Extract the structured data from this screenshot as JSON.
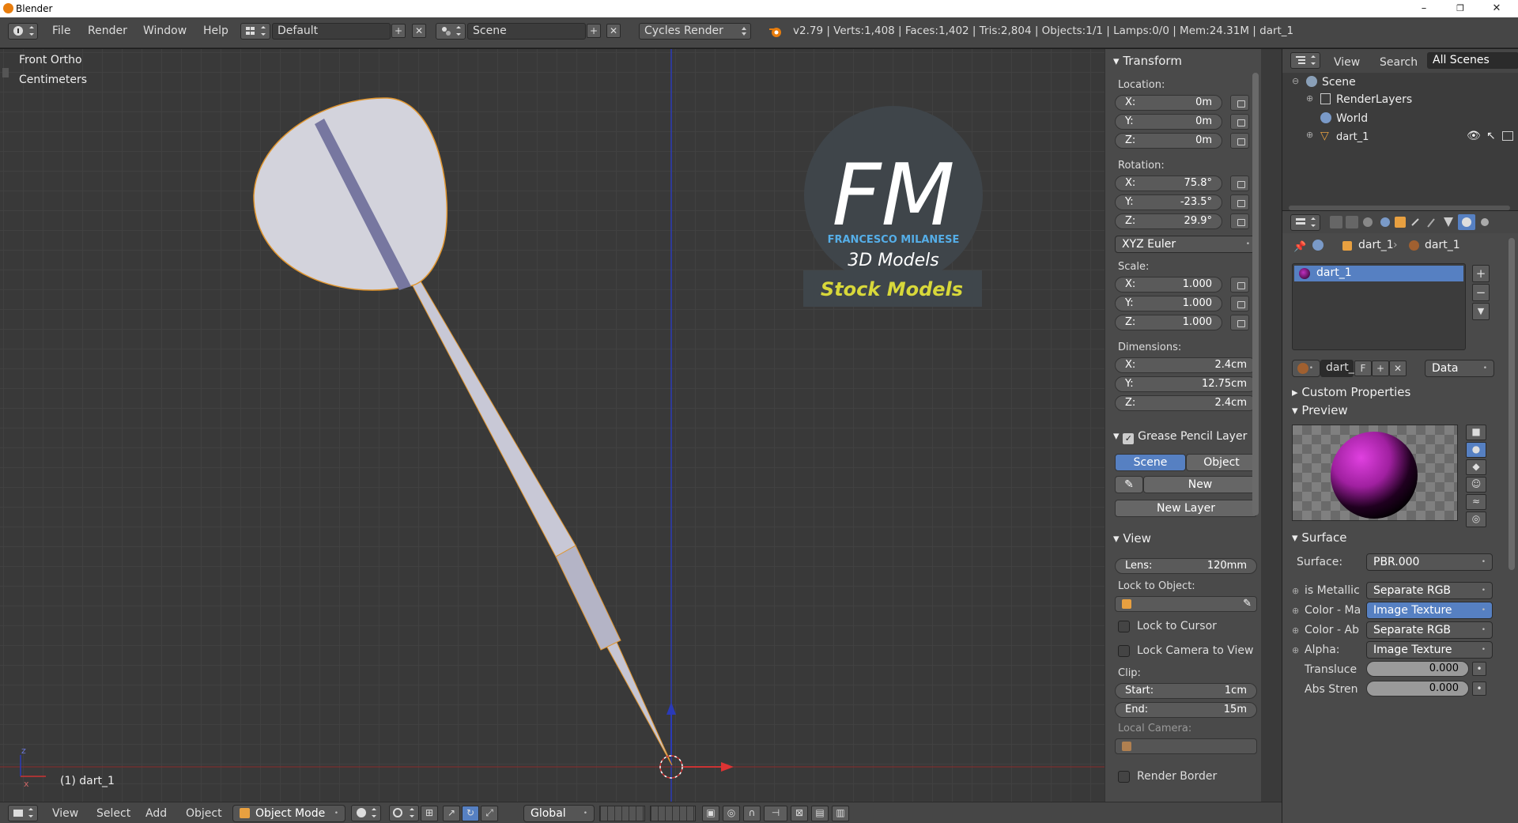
{
  "window": {
    "title": "Blender",
    "minimize": "–",
    "maximize": "❐",
    "close": "✕"
  },
  "menu": {
    "items": [
      "File",
      "Render",
      "Window",
      "Help"
    ]
  },
  "header": {
    "layout": "Default",
    "scene": "Scene",
    "engine": "Cycles Render",
    "stats": "v2.79 | Verts:1,408 | Faces:1,402 | Tris:2,804 | Objects:1/1 | Lamps:0/0 | Mem:24.31M | dart_1"
  },
  "viewport": {
    "view_name": "Front Ortho",
    "units": "Centimeters",
    "object_label": "(1) dart_1",
    "watermark": {
      "letters": "FM",
      "name": "FRANCESCO MILANESE",
      "sub": "3D Models",
      "banner": "Stock Models"
    }
  },
  "transform": {
    "title": "Transform",
    "location_label": "Location:",
    "location": [
      {
        "axis": "X:",
        "value": "0m"
      },
      {
        "axis": "Y:",
        "value": "0m"
      },
      {
        "axis": "Z:",
        "value": "0m"
      }
    ],
    "rotation_label": "Rotation:",
    "rotation": [
      {
        "axis": "X:",
        "value": "75.8°"
      },
      {
        "axis": "Y:",
        "value": "-23.5°"
      },
      {
        "axis": "Z:",
        "value": "29.9°"
      }
    ],
    "rotation_mode": "XYZ Euler",
    "scale_label": "Scale:",
    "scale": [
      {
        "axis": "X:",
        "value": "1.000"
      },
      {
        "axis": "Y:",
        "value": "1.000"
      },
      {
        "axis": "Z:",
        "value": "1.000"
      }
    ],
    "dimensions_label": "Dimensions:",
    "dimensions": [
      {
        "axis": "X:",
        "value": "2.4cm"
      },
      {
        "axis": "Y:",
        "value": "12.75cm"
      },
      {
        "axis": "Z:",
        "value": "2.4cm"
      }
    ]
  },
  "grease_pencil": {
    "title": "Grease Pencil Layer",
    "tab_scene": "Scene",
    "tab_object": "Object",
    "new": "New",
    "new_layer": "New Layer"
  },
  "view_panel": {
    "title": "View",
    "lens_label": "Lens:",
    "lens": "120mm",
    "lock_object": "Lock to Object:",
    "lock_cursor": "Lock to Cursor",
    "lock_camera": "Lock Camera to View",
    "clip": "Clip:",
    "start_label": "Start:",
    "start": "1cm",
    "end_label": "End:",
    "end": "15m",
    "local_camera": "Local Camera:",
    "render_border": "Render Border"
  },
  "outliner": {
    "view": "View",
    "search": "Search",
    "filter": "All Scenes",
    "items": [
      "Scene",
      "RenderLayers",
      "World",
      "dart_1"
    ]
  },
  "properties": {
    "breadcrumb_obj": "dart_1",
    "breadcrumb_mat": "dart_1",
    "slot": "dart_1",
    "mat_name": "dart_",
    "f_label": "F",
    "link": "Data",
    "custom_props": "Custom Properties",
    "preview": "Preview",
    "surface_title": "Surface",
    "surface_label": "Surface:",
    "surface_value": "PBR.000",
    "sockets": [
      {
        "label": "is Metallic",
        "value": "Separate RGB"
      },
      {
        "label": "Color - Ma",
        "value": "Image Texture"
      },
      {
        "label": "Color - Ab",
        "value": "Separate RGB"
      },
      {
        "label": "Alpha:",
        "value": "Image Texture"
      }
    ],
    "translucency_label": "Transluce",
    "translucency": "0.000",
    "abs_label": "Abs Stren",
    "abs": "0.000"
  },
  "footer": {
    "view": "View",
    "select": "Select",
    "add": "Add",
    "object": "Object",
    "mode": "Object Mode",
    "orientation": "Global"
  },
  "colors": {
    "accent_blue": "#5680c2",
    "selection_orange": "#f0a040",
    "axis_x": "#d03030",
    "axis_z": "#2040c0"
  }
}
